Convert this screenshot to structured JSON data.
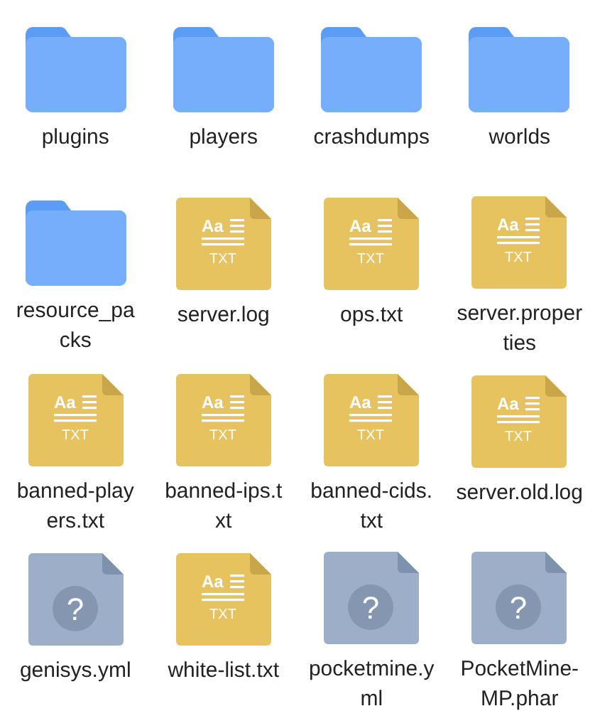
{
  "files": [
    {
      "name": "plugins",
      "kind": "folder"
    },
    {
      "name": "players",
      "kind": "folder"
    },
    {
      "name": "crashdumps",
      "kind": "folder"
    },
    {
      "name": "worlds",
      "kind": "folder"
    },
    {
      "name": "resource_packs",
      "kind": "folder"
    },
    {
      "name": "server.log",
      "kind": "text",
      "mark": "Aa",
      "badge": "TXT"
    },
    {
      "name": "ops.txt",
      "kind": "text",
      "mark": "Aa",
      "badge": "TXT"
    },
    {
      "name": "server.properties",
      "kind": "text",
      "mark": "Aa",
      "badge": "TXT"
    },
    {
      "name": "banned-players.txt",
      "kind": "text",
      "mark": "Aa",
      "badge": "TXT"
    },
    {
      "name": "banned-ips.txt",
      "kind": "text",
      "mark": "Aa",
      "badge": "TXT"
    },
    {
      "name": "banned-cids.txt",
      "kind": "text",
      "mark": "Aa",
      "badge": "TXT"
    },
    {
      "name": "server.old.log",
      "kind": "text",
      "mark": "Aa",
      "badge": "TXT"
    },
    {
      "name": "genisys.yml",
      "kind": "unknown",
      "glyph": "?"
    },
    {
      "name": "white-list.txt",
      "kind": "text",
      "mark": "Aa",
      "badge": "TXT"
    },
    {
      "name": "pocketmine.yml",
      "kind": "unknown",
      "glyph": "?"
    },
    {
      "name": "PocketMine-MP.phar",
      "kind": "unknown",
      "glyph": "?"
    }
  ]
}
